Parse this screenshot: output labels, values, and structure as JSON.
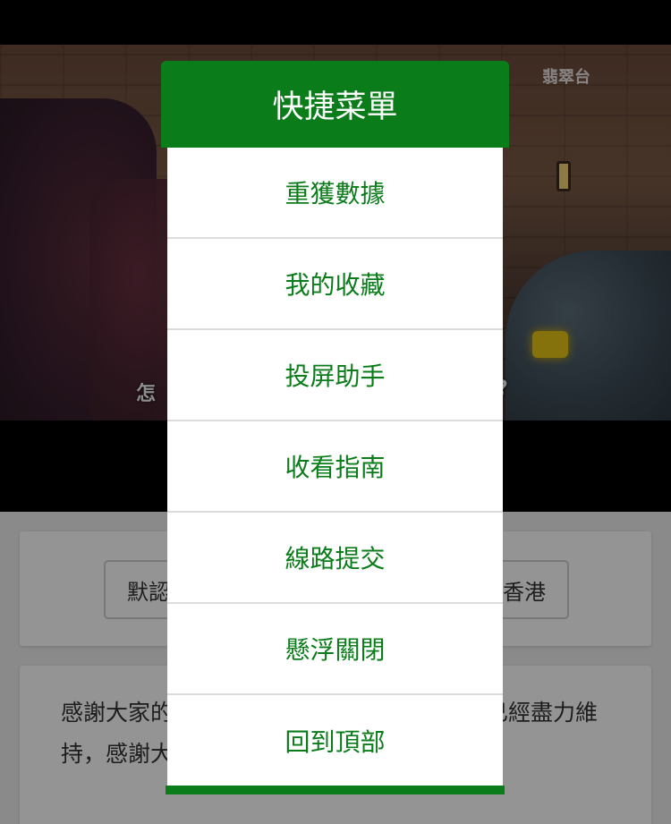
{
  "video": {
    "channel_logo": "翡翠台",
    "subtitle_left": "怎",
    "subtitle_right": "?"
  },
  "line_selector": {
    "left_button": "默認",
    "right_button": "香港"
  },
  "notice": {
    "text": "感謝大家的支持，由於伺服器資金問題，但已經盡力維持，感謝大家的一路相伴！！"
  },
  "menu": {
    "title": "快捷菜單",
    "items": [
      {
        "label": "重獲數據"
      },
      {
        "label": "我的收藏"
      },
      {
        "label": "投屏助手"
      },
      {
        "label": "收看指南"
      },
      {
        "label": "線路提交"
      },
      {
        "label": "懸浮關閉"
      },
      {
        "label": "回到頂部"
      }
    ]
  },
  "colors": {
    "accent": "#0b7c1a",
    "menu_text": "#0b7c1a",
    "page_bg": "#eeeeee"
  }
}
